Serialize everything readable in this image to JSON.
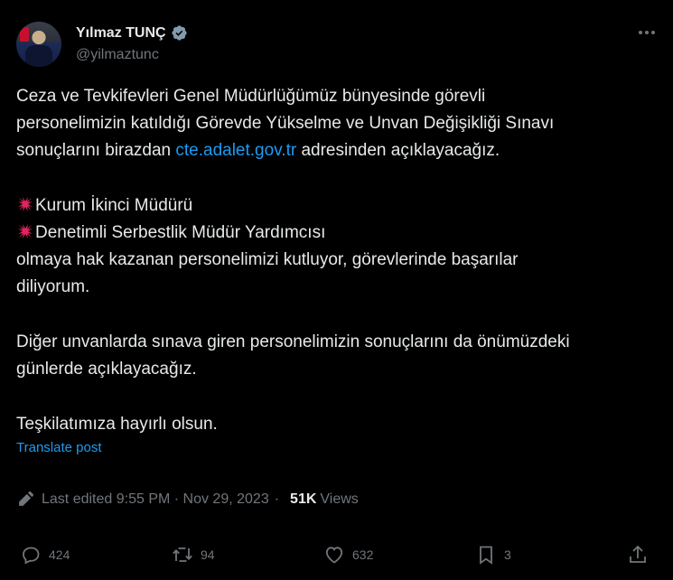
{
  "author": {
    "name": "Yılmaz TUNÇ",
    "handle": "@yilmaztunc"
  },
  "post": {
    "line1": "Ceza ve Tevkifevleri Genel Müdürlüğümüz bünyesinde görevli",
    "line2": "personelimizin katıldığı Görevde Yükselme ve Unvan Değişikliği Sınavı",
    "line3_pre": "sonuçlarını birazdan ",
    "line3_link": "cte.adalet.gov.tr",
    "line3_post": " adresinden açıklayacağız.",
    "item1": "Kurum İkinci Müdürü",
    "item2": "Denetimli Serbestlik Müdür Yardımcısı",
    "para2_line1": "olmaya hak kazanan personelimizi kutluyor, görevlerinde başarılar",
    "para2_line2": "diliyorum.",
    "para3_line1": "Diğer unvanlarda sınava giren personelimizin sonuçlarını da önümüzdeki",
    "para3_line2": "günlerde açıklayacağız.",
    "para4": "Teşkilatımıza hayırlı olsun."
  },
  "translate_label": "Translate post",
  "meta": {
    "edited": "Last edited 9:55 PM · Nov 29, 2023",
    "sep": "·",
    "views_count": "51K",
    "views_label": "Views"
  },
  "actions": {
    "replies": "424",
    "reposts": "94",
    "likes": "632",
    "bookmarks": "3"
  },
  "colors": {
    "background": "#000000",
    "text": "#e7e9ea",
    "muted": "#71767b",
    "link": "#1d9bf0"
  }
}
